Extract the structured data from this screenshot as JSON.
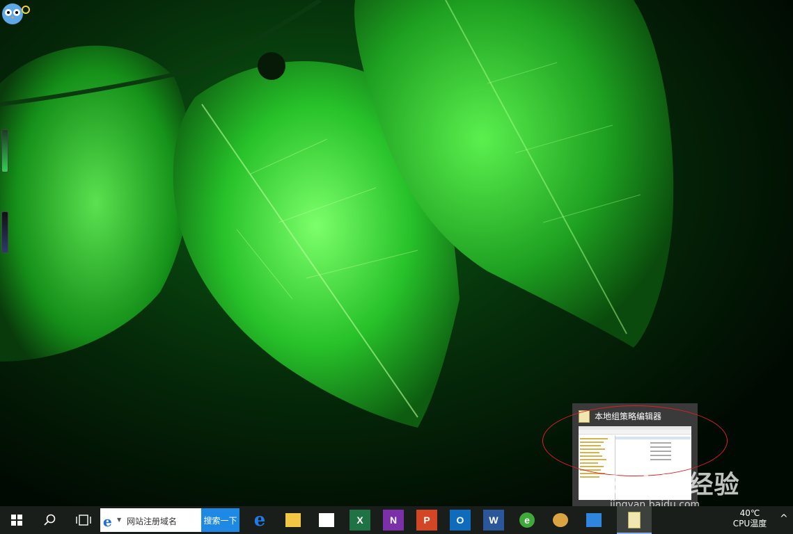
{
  "desktop": {
    "wallpaper": "green-leaves-wallpaper",
    "gadget_icon": "owl-icon"
  },
  "preview": {
    "title": "本地组策略编辑器",
    "icon": "policy-editor-icon"
  },
  "watermark": {
    "brand": "Baidu经验",
    "url": "jingyan.baidu.com"
  },
  "taskbar": {
    "start_icon": "windows-logo-icon",
    "search_icon": "search-icon",
    "taskview_icon": "task-view-icon",
    "search_box": {
      "text": "网站注册域名",
      "button": "搜索一下"
    },
    "apps": [
      {
        "name": "edge-icon",
        "glyph": "e",
        "color": "#1e7be8"
      },
      {
        "name": "file-explorer-icon",
        "glyph": "",
        "color": "#f2c744"
      },
      {
        "name": "store-icon",
        "glyph": "",
        "color": "#ffffff"
      },
      {
        "name": "excel-icon",
        "glyph": "X",
        "color": "#1f7244"
      },
      {
        "name": "onenote-icon",
        "glyph": "N",
        "color": "#7b2fa8"
      },
      {
        "name": "powerpoint-icon",
        "glyph": "P",
        "color": "#d24625"
      },
      {
        "name": "outlook-icon",
        "glyph": "O",
        "color": "#0f6cbd"
      },
      {
        "name": "word-icon",
        "glyph": "W",
        "color": "#2b579a"
      },
      {
        "name": "browser-360-icon",
        "glyph": "e",
        "color": "#3fa93c"
      },
      {
        "name": "paint-icon",
        "glyph": "",
        "color": "#d9a441"
      },
      {
        "name": "control-panel-icon",
        "glyph": "",
        "color": "#2e86de"
      },
      {
        "name": "policy-editor-icon",
        "glyph": "",
        "color": "#f1e7b0"
      }
    ],
    "tray": {
      "temperature": "40℃",
      "label": "CPU温度"
    },
    "chevron": "^"
  },
  "colors": {
    "taskbar": "#1a1e1b",
    "annotation": "#e02020",
    "search_button": "#1e88e5"
  }
}
